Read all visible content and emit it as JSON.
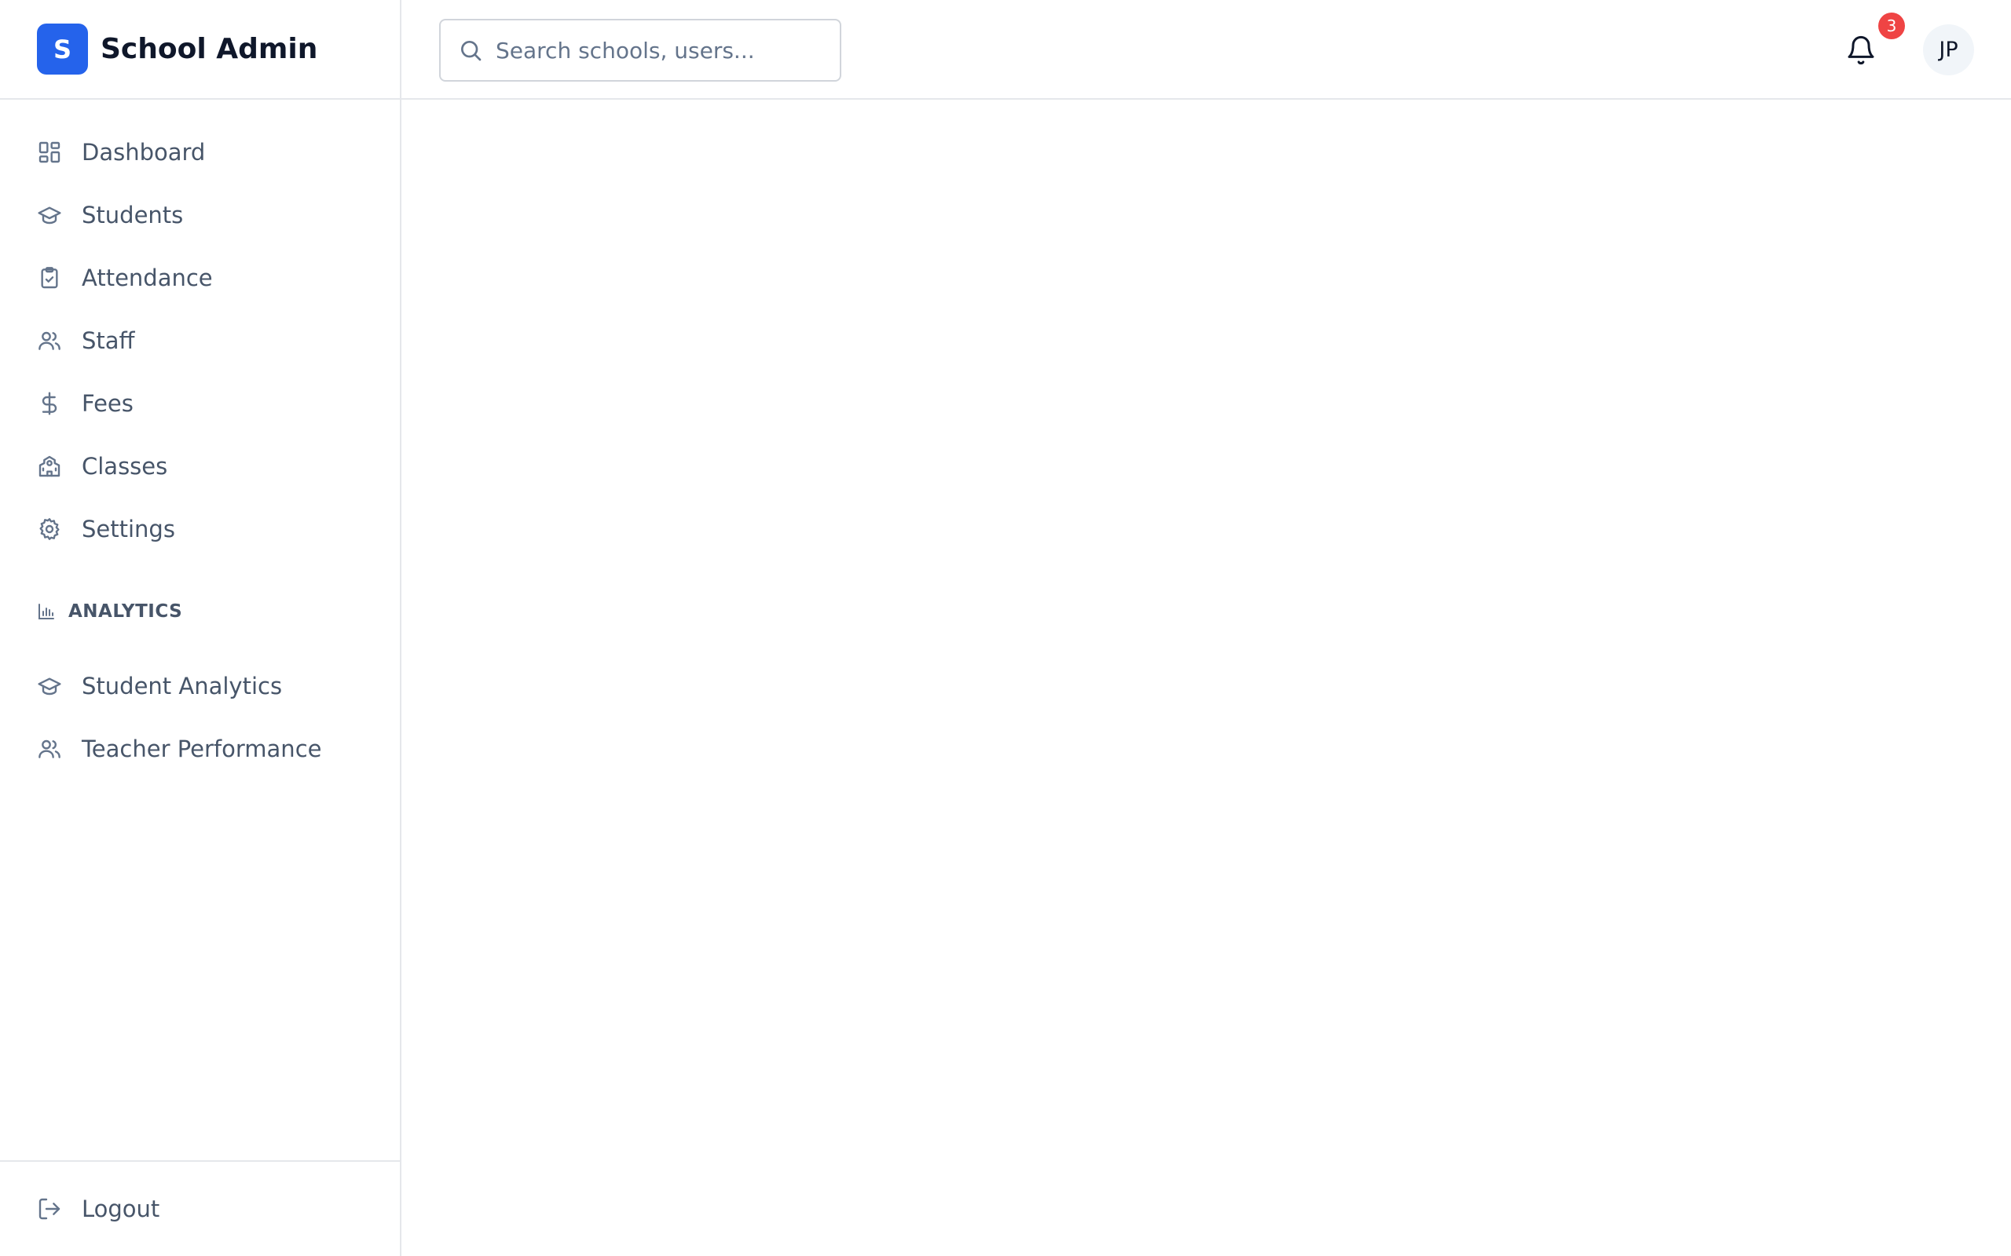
{
  "brand": {
    "logo_letter": "S",
    "name": "School Admin",
    "accent": "#2563eb"
  },
  "sidebar": {
    "items": [
      {
        "label": "Dashboard",
        "icon": "dashboard-icon"
      },
      {
        "label": "Students",
        "icon": "graduation-cap-icon"
      },
      {
        "label": "Attendance",
        "icon": "clipboard-check-icon"
      },
      {
        "label": "Staff",
        "icon": "users-icon"
      },
      {
        "label": "Fees",
        "icon": "dollar-icon"
      },
      {
        "label": "Classes",
        "icon": "school-icon"
      },
      {
        "label": "Settings",
        "icon": "gear-icon"
      }
    ],
    "analytics": {
      "title": "ANALYTICS",
      "icon": "bar-chart-icon",
      "items": [
        {
          "label": "Student Analytics",
          "icon": "graduation-cap-icon"
        },
        {
          "label": "Teacher Performance",
          "icon": "users-icon"
        }
      ]
    },
    "logout": {
      "label": "Logout",
      "icon": "logout-icon"
    }
  },
  "header": {
    "search": {
      "placeholder": "Search schools, users...",
      "value": ""
    },
    "notifications": {
      "count": "3",
      "badge_color": "#ef4444"
    },
    "user": {
      "initials": "JP"
    }
  }
}
